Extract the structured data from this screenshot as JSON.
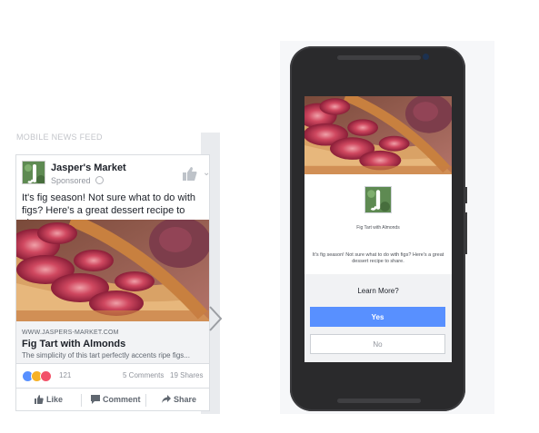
{
  "feed": {
    "caption": "MOBILE NEWS FEED",
    "page_name": "Jasper's Market",
    "sponsored": "Sponsored",
    "post_text": "It's fig season! Not sure what to do with figs? Here's a great dessert recipe to share.",
    "link": {
      "domain": "WWW.JASPERS-MARKET.COM",
      "title": "Fig Tart with Almonds",
      "description": "The simplicity of this tart perfectly accents ripe figs..."
    },
    "reactions_count": "121",
    "comments": "5 Comments",
    "shares": "19 Shares",
    "actions": {
      "like": "Like",
      "comment": "Comment",
      "share": "Share"
    },
    "icons": [
      "globe-icon",
      "like-thumb-icon",
      "chevron-down-icon",
      "like-reaction-icon",
      "wow-reaction-icon",
      "love-reaction-icon",
      "next-arrow-icon"
    ]
  },
  "phone": {
    "ad_title": "Fig Tart with Almonds",
    "ad_text": "It's fig season! Not sure what to do with figs? Here's a great dessert recipe to share.",
    "prompt": "Learn More?",
    "yes_label": "Yes",
    "no_label": "No"
  },
  "colors": {
    "brand_blue": "#5890ff",
    "avatar_green": "#5e8a52",
    "fig_red": "#b8324a",
    "crust": "#d08a4c"
  }
}
